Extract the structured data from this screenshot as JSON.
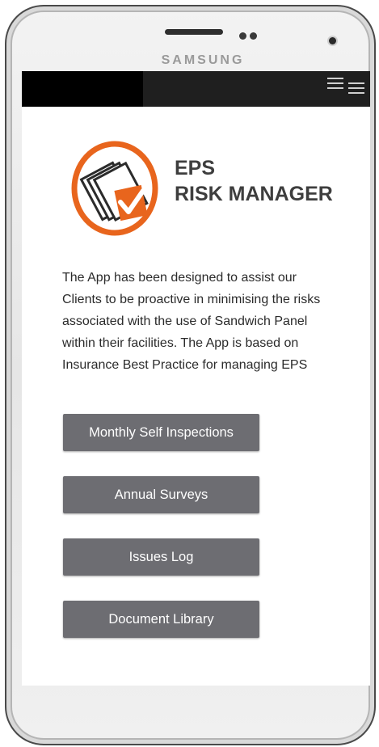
{
  "device": {
    "brand": "SAMSUNG"
  },
  "app": {
    "title_line1": "EPS",
    "title_line2": "RISK MANAGER",
    "logo_icon": "document-checkmark-icon",
    "accent_color": "#e8651d",
    "intro_text": "The App has been designed  to assist our Clients to be proactive in minimising the risks associated with the use of Sandwich Panel within their facilities. The App is based on Insurance Best Practice for managing EPS"
  },
  "menu": {
    "icon": "hamburger-menu-icon",
    "buttons": [
      {
        "label": "Monthly Self Inspections"
      },
      {
        "label": "Annual Surveys"
      },
      {
        "label": "Issues Log"
      },
      {
        "label": "Document Library"
      }
    ]
  }
}
